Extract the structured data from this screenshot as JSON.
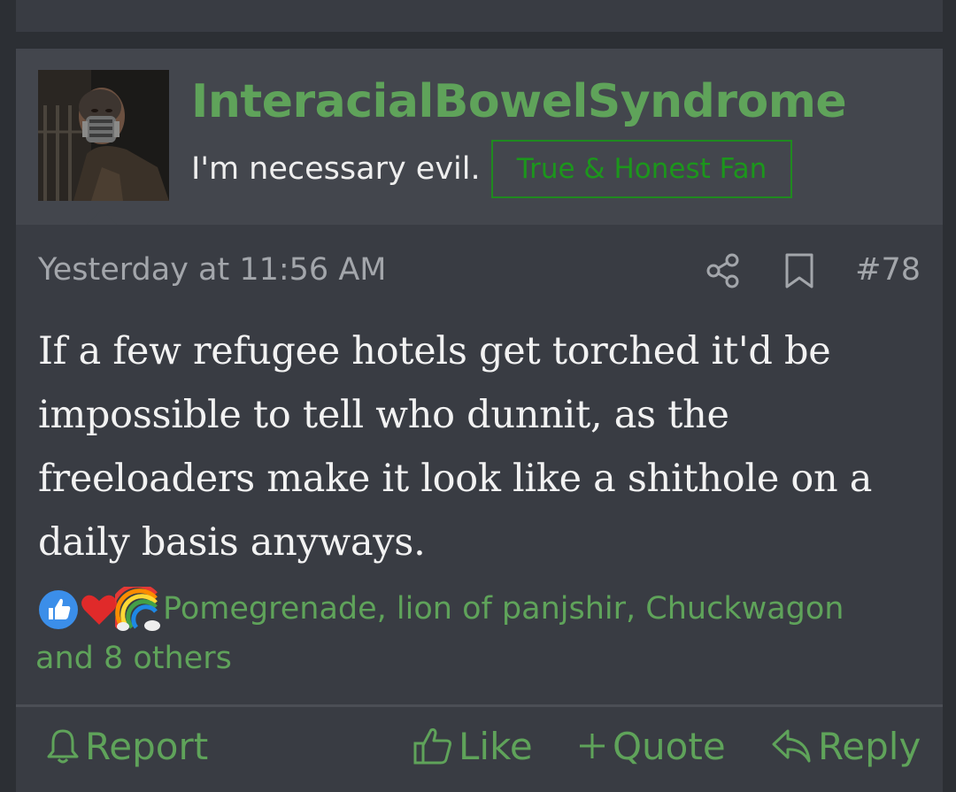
{
  "post": {
    "username": "InteracialBowelSyndrome",
    "user_title": "I'm necessary evil.",
    "user_banner": "True & Honest Fan",
    "date": "Yesterday at 11:56 AM",
    "post_number": "#78",
    "body_lines": [
      "If a few refugee hotels get torched it'd be",
      "impossible to tell who dunnit, as the",
      "freeloaders make it look like a shithole on a",
      "daily basis anyways."
    ],
    "reactions": {
      "icons": [
        "thumbs-up-icon",
        "heart-icon",
        "rainbow-icon"
      ],
      "text_line1": "Pomegrenade, lion of panjshir, Chuckwagon",
      "text_line2": "and 8 others"
    },
    "actions": {
      "report": "Report",
      "like": "Like",
      "quote": "Quote",
      "reply": "Reply"
    }
  },
  "colors": {
    "accent_green": "#5fa35a",
    "banner_green": "#1c961c",
    "post_bg": "#393c43",
    "header_bg": "#43464d",
    "page_bg": "#2c2f34"
  }
}
